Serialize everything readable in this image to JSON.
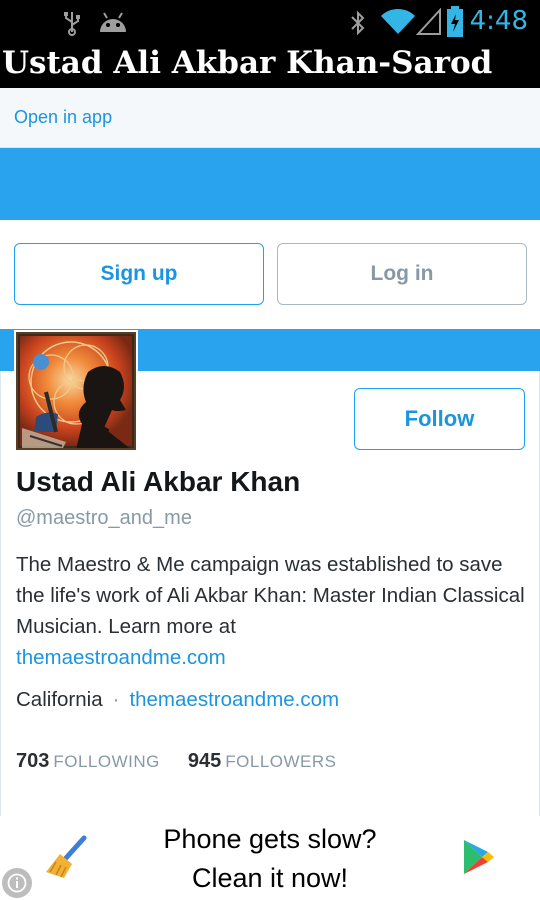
{
  "status_bar": {
    "time": "4:48",
    "icons": [
      "usb-icon",
      "android-icon",
      "bluetooth-icon",
      "wifi-icon",
      "signal-icon",
      "battery-icon"
    ],
    "accent_color": "#33b5e5"
  },
  "app": {
    "title": "Ustad Ali Akbar Khan-Sarod"
  },
  "header": {
    "open_in_app": "Open in app"
  },
  "auth": {
    "signup_label": "Sign up",
    "login_label": "Log in"
  },
  "profile": {
    "name": "Ustad Ali Akbar Khan",
    "handle": "@maestro_and_me",
    "follow_label": "Follow",
    "bio_text": "The Maestro & Me campaign was established to save the life's work of Ali Akbar Khan: Master Indian Classical Musician. Learn more at",
    "bio_link": "themaestroandme.com",
    "location": "California",
    "separator": "·",
    "website": "themaestroandme.com",
    "following_count": "703",
    "following_label": "FOLLOWING",
    "followers_count": "945",
    "followers_label": "FOLLOWERS"
  },
  "ad": {
    "line1": "Phone gets slow?",
    "line2": "Clean it now!"
  },
  "colors": {
    "brand_blue": "#1da1f2",
    "banner_blue": "#2aa3ef",
    "link_blue": "#1b95e0",
    "muted_gray": "#8899a6"
  }
}
